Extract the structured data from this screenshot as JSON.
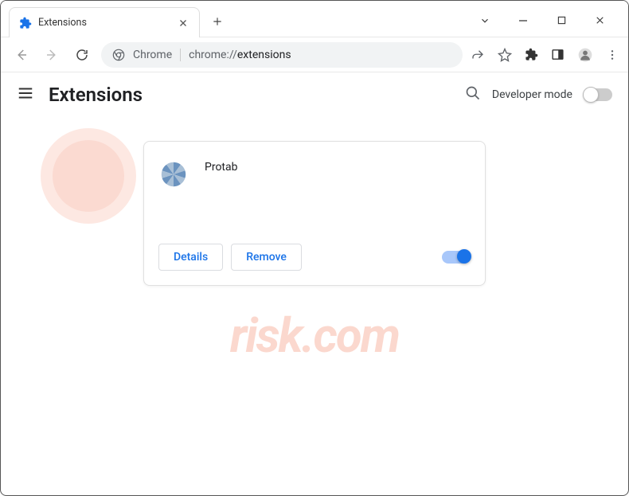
{
  "tab": {
    "title": "Extensions"
  },
  "omnibox": {
    "label": "Chrome",
    "url_prefix": "chrome://",
    "url_path": "extensions"
  },
  "page": {
    "title": "Extensions",
    "developer_mode_label": "Developer mode"
  },
  "extension": {
    "name": "Protab",
    "details_label": "Details",
    "remove_label": "Remove",
    "enabled": true
  }
}
